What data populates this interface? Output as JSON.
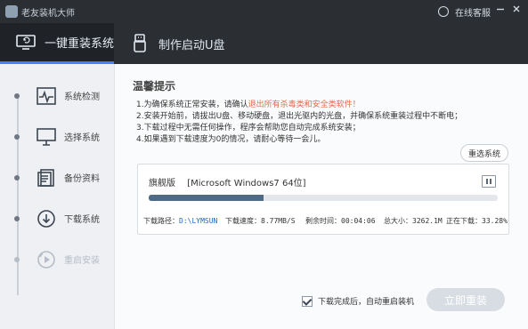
{
  "titlebar": {
    "app_title": "老友装机大师",
    "help_label": "在线客服"
  },
  "tabs": [
    {
      "label": "一键重装系统"
    },
    {
      "label": "制作启动U盘"
    }
  ],
  "sidebar": {
    "steps": [
      {
        "label": "系统检测",
        "icon": "pulse-icon"
      },
      {
        "label": "选择系统",
        "icon": "monitor-icon"
      },
      {
        "label": "备份资料",
        "icon": "files-icon"
      },
      {
        "label": "下载系统",
        "icon": "download-icon"
      },
      {
        "label": "重启安装",
        "icon": "restart-icon"
      }
    ]
  },
  "main": {
    "heading": "温馨提示",
    "notes": {
      "line1_prefix": "1.为确保系统正常安装，请确认",
      "line1_warn": "退出所有杀毒类和安全类软件！",
      "line2": "2.安装开始前，请拔出U盘、移动硬盘，退出光驱内的光盘，并确保系统重装过程中不断电；",
      "line3": "3.下载过程中无需任何操作，程序会帮助您自动完成系统安装；",
      "line4": "4.如果遇到下载速度为0的情况，请耐心等待一会儿。"
    },
    "reselect_label": "重选系统",
    "download": {
      "edition": "旗舰版",
      "system_name": "[Microsoft Windows7 64位]",
      "progress_fraction": 0.33
    },
    "stats": {
      "path_label": "下载路径：",
      "path_value": "D:\\LYMSUN",
      "speed_label": "下载速度：",
      "speed_value": "8.77MB/S",
      "remaining_label": "剩余时间：",
      "remaining_value": "00:04:06",
      "total_label": "总大小：",
      "total_value": "3262.1M",
      "downloading_label": "正在下载：",
      "downloading_value": "33.28%"
    },
    "auto_restart_label": "下载完成后，自动重启装机",
    "reinstall_label": "立即重装"
  },
  "colors": {
    "accent": "#3a84ff",
    "warn": "#e06b4b",
    "progress": "#4f6a86",
    "link_value": "#1f66c7"
  }
}
